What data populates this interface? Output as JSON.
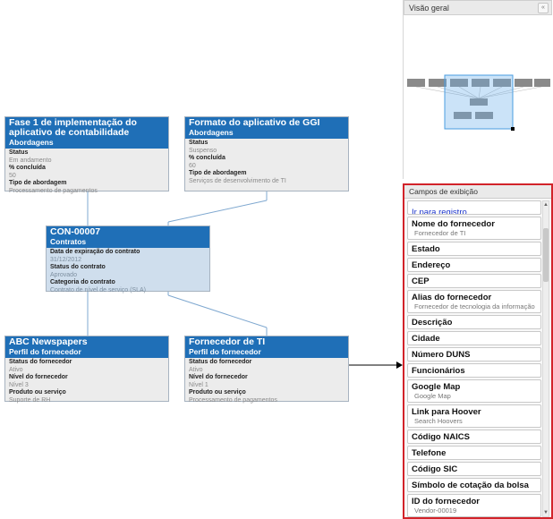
{
  "diagram": {
    "nodes": {
      "phase1": {
        "title": "Fase 1 de implementação do aplicativo de contabilidade",
        "type": "Abordagens",
        "fields": [
          {
            "label": "Status",
            "value": "Em andamento"
          },
          {
            "label": "% concluída",
            "value": "50"
          },
          {
            "label": "Tipo de abordagem",
            "value": "Processamento de pagamentos"
          }
        ]
      },
      "ggi": {
        "title": "Formato do aplicativo de GGI",
        "type": "Abordagens",
        "fields": [
          {
            "label": "Status",
            "value": "Suspenso"
          },
          {
            "label": "% concluída",
            "value": "60"
          },
          {
            "label": "Tipo de abordagem",
            "value": "Serviços de desenvolvimento de TI"
          }
        ]
      },
      "contract": {
        "title": "CON-00007",
        "type": "Contratos",
        "fields": [
          {
            "label": "Data de expiração do contrato",
            "value": "31/12/2012"
          },
          {
            "label": "Status do contrato",
            "value": "Aprovado"
          },
          {
            "label": "Categoria do contrato",
            "value": "Contrato de nível de serviço (SLA)"
          }
        ]
      },
      "abc": {
        "title": "ABC Newspapers",
        "type": "Perfil do fornecedor",
        "fields": [
          {
            "label": "Status do fornecedor",
            "value": "Ativo"
          },
          {
            "label": "Nível do fornecedor",
            "value": "Nível 3"
          },
          {
            "label": "Produto ou serviço",
            "value": "Suporte de RH"
          }
        ]
      },
      "ti": {
        "title": "Fornecedor de TI",
        "type": "Perfil do fornecedor",
        "fields": [
          {
            "label": "Status do fornecedor",
            "value": "Ativo"
          },
          {
            "label": "Nível do fornecedor",
            "value": "Nível 1"
          },
          {
            "label": "Produto ou serviço",
            "value": "Processamento de pagamentos"
          }
        ]
      }
    }
  },
  "overview": {
    "title": "Visão geral",
    "collapse_icon": "double-chevron-left-icon"
  },
  "fields_panel": {
    "title": "Campos de exibição",
    "link_label": "Ir para registro",
    "items": [
      {
        "label": "Nome do fornecedor",
        "sub": "Fornecedor de TI"
      },
      {
        "label": "Estado",
        "sub": ""
      },
      {
        "label": "Endereço",
        "sub": ""
      },
      {
        "label": "CEP",
        "sub": ""
      },
      {
        "label": "Alias do fornecedor",
        "sub": "Fornecedor de tecnologia da informação"
      },
      {
        "label": "Descrição",
        "sub": ""
      },
      {
        "label": "Cidade",
        "sub": ""
      },
      {
        "label": "Número DUNS",
        "sub": ""
      },
      {
        "label": "Funcionários",
        "sub": ""
      },
      {
        "label": "Google Map",
        "sub": "Google Map"
      },
      {
        "label": "Link para Hoover",
        "sub": "Search Hoovers"
      },
      {
        "label": "Código NAICS",
        "sub": ""
      },
      {
        "label": "Telefone",
        "sub": ""
      },
      {
        "label": "Código SIC",
        "sub": ""
      },
      {
        "label": "Símbolo de cotação da bolsa",
        "sub": ""
      },
      {
        "label": "ID do fornecedor",
        "sub": "Vendor-00019"
      }
    ]
  },
  "colors": {
    "node_header": "#1f6fb7",
    "node_body": "#ececec",
    "selected_node_body": "#cfdeed",
    "panel_highlight_border": "#d2232a",
    "link_text": "#1a33cc"
  }
}
